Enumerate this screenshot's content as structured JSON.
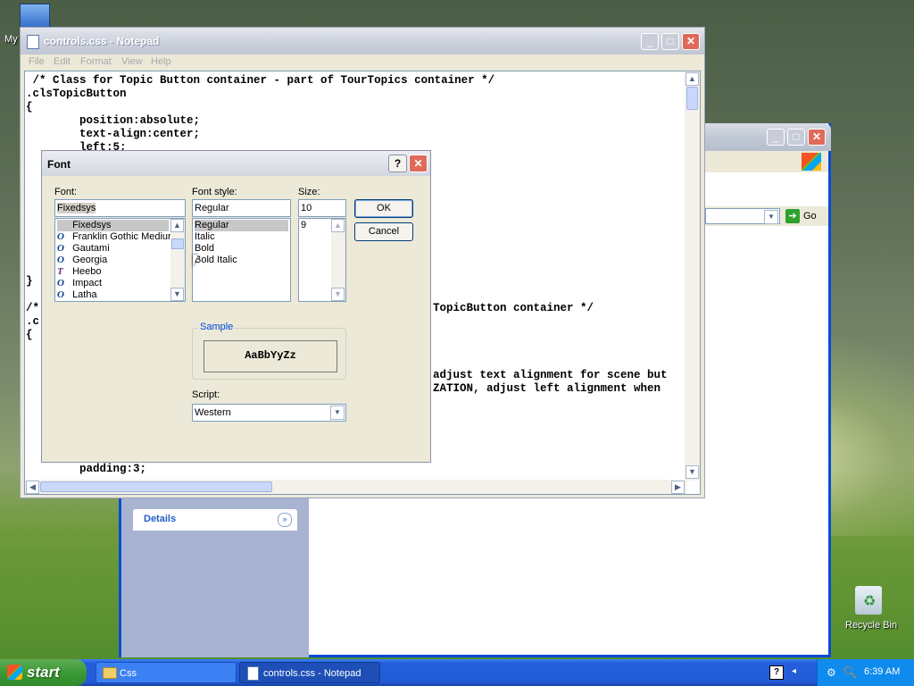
{
  "desktop": {
    "icons": [
      {
        "label": "My"
      },
      {
        "label": "Recycle Bin"
      }
    ]
  },
  "explorer": {
    "go_label": "Go",
    "details_label": "Details"
  },
  "notepad": {
    "title": "controls.css - Notepad",
    "menu": [
      "File",
      "Edit",
      "Format",
      "View",
      "Help"
    ],
    "code_top": [
      " /* Class for Topic Button container - part of TourTopics container */",
      ".clsTopicButton",
      "{",
      "        position:absolute;",
      "        text-align:center;",
      "        left:5;"
    ],
    "code_closing": "}",
    "code_left_fragments": [
      "/*",
      ".c",
      "{"
    ],
    "code_right": [
      "TopicButton container */",
      "",
      "",
      "",
      "",
      "adjust text alignment for scene but",
      "ZATION, adjust left alignment when"
    ],
    "code_bottom": "        padding:3;"
  },
  "font_dialog": {
    "title": "Font",
    "help_glyph": "?",
    "close_glyph": "✕",
    "font_label": "Font:",
    "font_value": "Fixedsys",
    "font_list": [
      {
        "name": "Fixedsys",
        "icon": "",
        "selected": true
      },
      {
        "name": "Franklin Gothic Mediur",
        "icon": "O"
      },
      {
        "name": "Gautami",
        "icon": "O"
      },
      {
        "name": "Georgia",
        "icon": "O"
      },
      {
        "name": "Heebo",
        "icon": "T"
      },
      {
        "name": "Impact",
        "icon": "O"
      },
      {
        "name": "Latha",
        "icon": "O"
      }
    ],
    "style_label": "Font style:",
    "style_value": "Regular",
    "style_list": [
      "Regular",
      "Italic",
      "Bold",
      "Bold Italic"
    ],
    "size_label": "Size:",
    "size_value": "10",
    "size_list": [
      "9"
    ],
    "ok_label": "OK",
    "cancel_label": "Cancel",
    "sample_label": "Sample",
    "sample_text": "AaBbYyZz",
    "script_label": "Script:",
    "script_value": "Western"
  },
  "taskbar": {
    "start_label": "start",
    "tasks": [
      {
        "label": "Css",
        "active": false
      },
      {
        "label": "controls.css - Notepad",
        "active": true
      }
    ],
    "clock": "6:39 AM"
  }
}
